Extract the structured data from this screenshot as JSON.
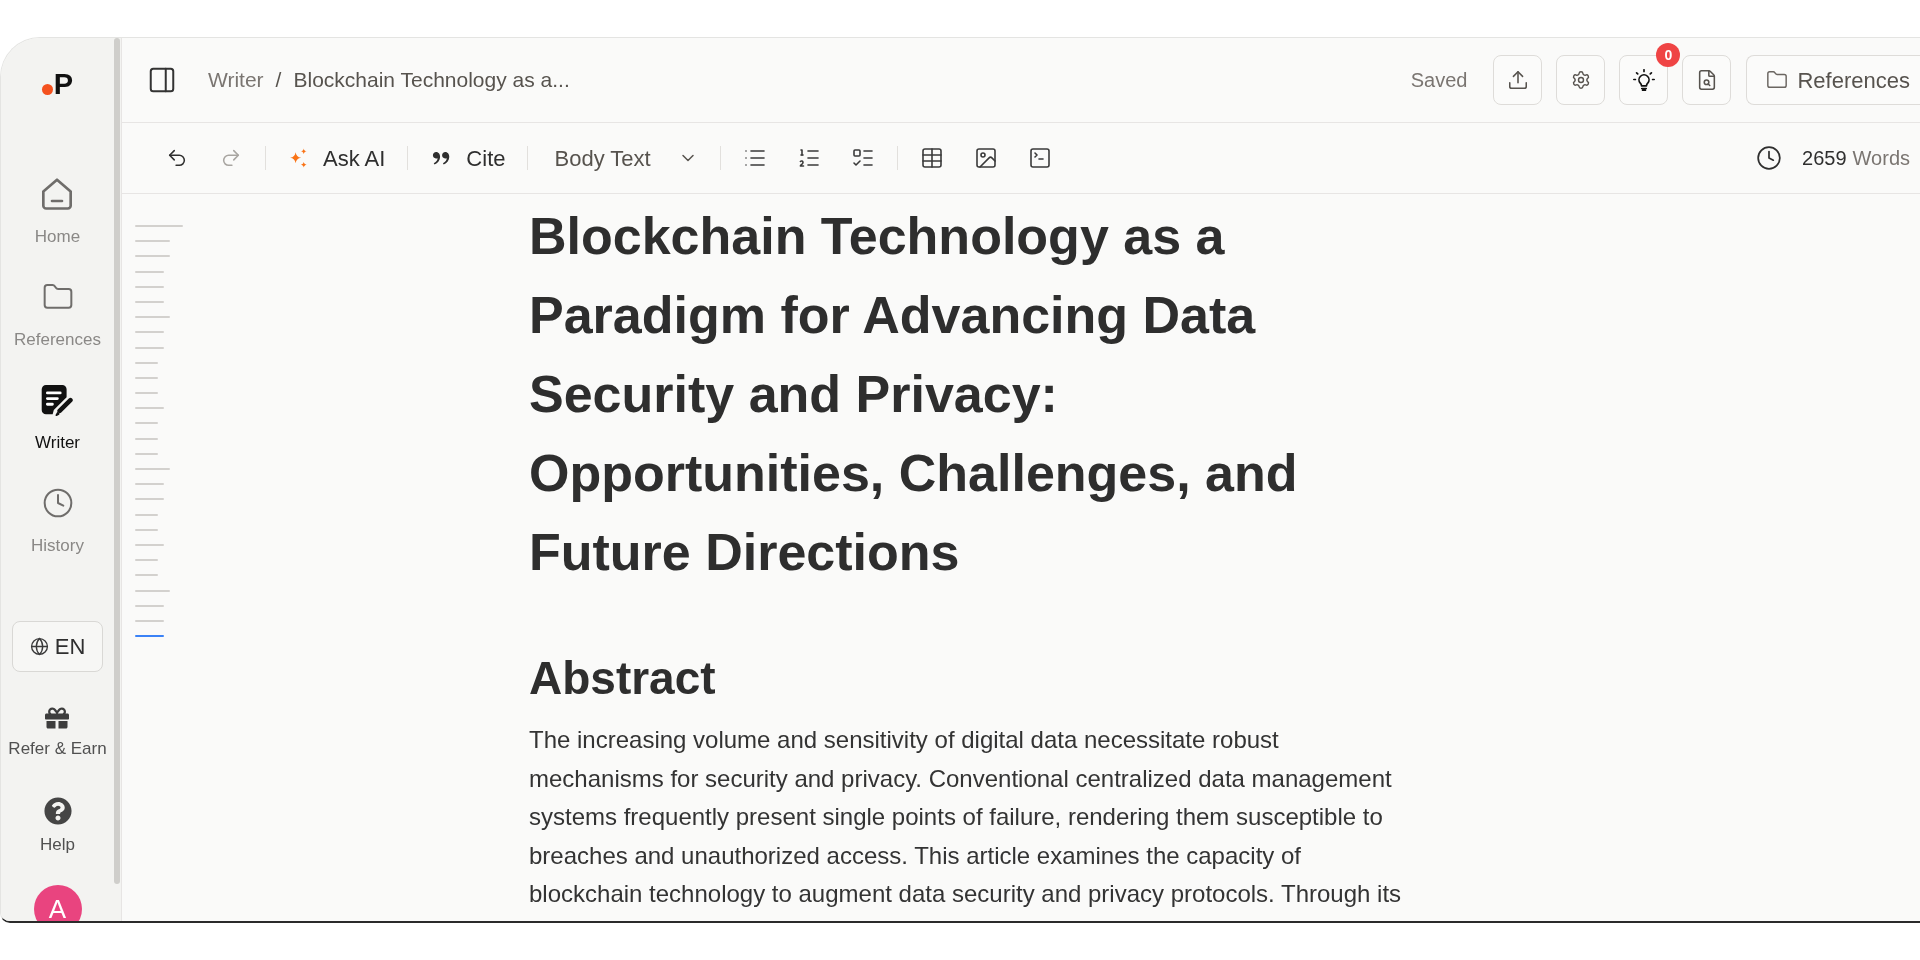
{
  "sidebar": {
    "logo": {
      "text": "P"
    },
    "nav_items": [
      {
        "kind": "home",
        "label": "Home",
        "selected": false
      },
      {
        "kind": "references",
        "label": "References",
        "selected": false
      },
      {
        "kind": "writer",
        "label": "Writer",
        "selected": true
      },
      {
        "kind": "history",
        "label": "History",
        "selected": false
      }
    ],
    "language_button": {
      "label": "EN"
    },
    "bottom_items": [
      {
        "kind": "gift",
        "label": "Refer & Earn"
      },
      {
        "kind": "help",
        "label": "Help"
      }
    ],
    "avatar": {
      "initial": "A"
    }
  },
  "header": {
    "breadcrumb": [
      {
        "label": "Writer"
      },
      {
        "label": "Blockchain Technology as a..."
      }
    ],
    "separator": "/",
    "save_status": "Saved",
    "action_buttons": [
      {
        "kind": "export"
      },
      {
        "kind": "settings"
      },
      {
        "kind": "ideas",
        "badge": "0"
      },
      {
        "kind": "review"
      }
    ],
    "references_button": {
      "label": "References"
    }
  },
  "toolbar": {
    "history": [
      {
        "kind": "undo",
        "disabled": false
      },
      {
        "kind": "redo",
        "disabled": true
      }
    ],
    "ask_ai": {
      "label": "Ask AI"
    },
    "cite": {
      "label": "Cite"
    },
    "block_style": {
      "value": "Body Text"
    },
    "list_buttons": [
      {
        "kind": "bullet"
      },
      {
        "kind": "numbered"
      },
      {
        "kind": "checklist"
      }
    ],
    "insert_buttons": [
      {
        "kind": "table"
      },
      {
        "kind": "image"
      },
      {
        "kind": "code"
      }
    ],
    "word_count": {
      "count": "2659",
      "unit": "Words"
    }
  },
  "outline": [
    {
      "kind": "h1",
      "selected": false
    },
    {
      "kind": "h2",
      "selected": false
    },
    {
      "kind": "h2",
      "selected": false
    },
    {
      "kind": "h3",
      "selected": false
    },
    {
      "kind": "h3",
      "selected": false
    },
    {
      "kind": "h3",
      "selected": false
    },
    {
      "kind": "h2",
      "selected": false
    },
    {
      "kind": "h3",
      "selected": false
    },
    {
      "kind": "h3",
      "selected": false
    },
    {
      "kind": "h4",
      "selected": false
    },
    {
      "kind": "h4",
      "selected": false
    },
    {
      "kind": "h4",
      "selected": false
    },
    {
      "kind": "h3",
      "selected": false
    },
    {
      "kind": "h4",
      "selected": false
    },
    {
      "kind": "h4",
      "selected": false
    },
    {
      "kind": "h4",
      "selected": false
    },
    {
      "kind": "h2",
      "selected": false
    },
    {
      "kind": "h3",
      "selected": false
    },
    {
      "kind": "h3",
      "selected": false
    },
    {
      "kind": "h4",
      "selected": false
    },
    {
      "kind": "h4",
      "selected": false
    },
    {
      "kind": "h3",
      "selected": false
    },
    {
      "kind": "h4",
      "selected": false
    },
    {
      "kind": "h4",
      "selected": false
    },
    {
      "kind": "h2",
      "selected": false
    },
    {
      "kind": "h3",
      "selected": false
    },
    {
      "kind": "h3",
      "selected": false
    },
    {
      "kind": "h3",
      "selected": true
    }
  ],
  "document": {
    "title": "Blockchain Technology as a Paradigm for Advancing Data Security and Privacy: Opportunities, Challenges, and Future Directions",
    "sections": [
      {
        "heading": "Abstract",
        "paragraphs": [
          "The increasing volume and sensitivity of digital data necessitate robust mechanisms for security and privacy. Conventional centralized data management systems frequently present single points of failure, rendering them susceptible to breaches and unauthorized access. This article examines the capacity of blockchain technology to augment data security and privacy protocols. Through its"
        ]
      }
    ]
  }
}
